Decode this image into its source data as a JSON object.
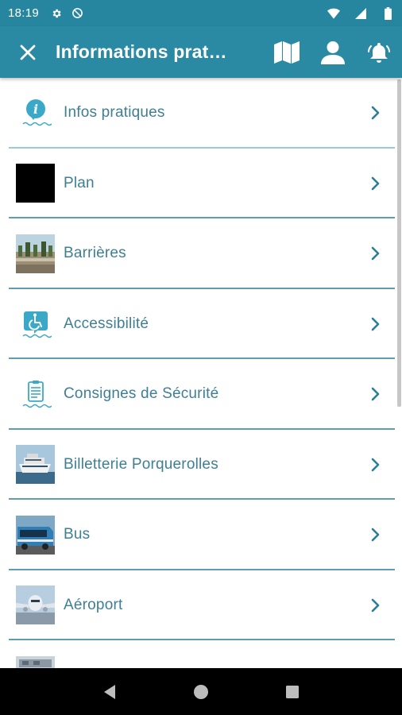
{
  "status_bar": {
    "time": "18:19",
    "icons": [
      "gear-icon",
      "no-disturb-icon",
      "wifi-icon",
      "signal-icon",
      "battery-icon"
    ]
  },
  "app_bar": {
    "title": "Informations prati…",
    "icons": [
      "close-icon",
      "map-icon",
      "user-icon",
      "bell-icon"
    ]
  },
  "list": {
    "items": [
      {
        "label": "Infos pratiques",
        "icon": "info-icon"
      },
      {
        "label": "Plan",
        "icon": "black-thumbnail"
      },
      {
        "label": "Barrières",
        "icon": "barriers-photo"
      },
      {
        "label": "Accessibilité",
        "icon": "wheelchair-icon"
      },
      {
        "label": "Consignes de Sécurité",
        "icon": "clipboard-icon"
      },
      {
        "label": "Billetterie Porquerolles",
        "icon": "ferry-photo"
      },
      {
        "label": "Bus",
        "icon": "bus-photo"
      },
      {
        "label": "Aéroport",
        "icon": "airplane-photo"
      },
      {
        "label": "",
        "icon": "train-photo"
      }
    ]
  },
  "colors": {
    "primary": "#2a8aa3",
    "status_bar": "#27869f",
    "text": "#3f7f93",
    "divider": "#2a7e95",
    "accent_icon": "#3aa9c7"
  }
}
